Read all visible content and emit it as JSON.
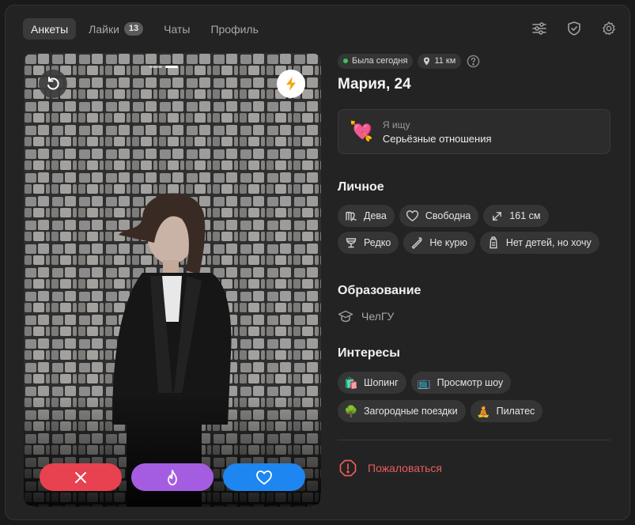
{
  "tabs": [
    {
      "label": "Анкеты",
      "active": true
    },
    {
      "label": "Лайки",
      "badge": "13"
    },
    {
      "label": "Чаты"
    },
    {
      "label": "Профиль"
    }
  ],
  "top_icons": [
    "filters-icon",
    "shield-icon",
    "settings-icon"
  ],
  "photo": {
    "photo_count": 2,
    "current_index": 1,
    "undo_icon": "undo-icon",
    "boost_icon": "lightning-icon"
  },
  "actions": {
    "dislike_icon": "close-icon",
    "super_icon": "flame-icon",
    "like_icon": "heart-icon"
  },
  "profile": {
    "status": "Была сегодня",
    "distance": "11 км",
    "name": "Мария, 24",
    "looking_label": "Я ищу",
    "looking_value": "Серьёзные отношения",
    "looking_emoji": "💘"
  },
  "personal": {
    "title": "Личное",
    "chips": [
      {
        "label": "Дева",
        "icon": "virgo-icon"
      },
      {
        "label": "Свободна",
        "icon": "heart-outline-icon"
      },
      {
        "label": "161 см",
        "icon": "height-icon"
      },
      {
        "label": "Редко",
        "icon": "glass-icon"
      },
      {
        "label": "Не курю",
        "icon": "no-smoking-icon"
      },
      {
        "label": "Нет детей, но хочу",
        "icon": "bottle-icon"
      }
    ]
  },
  "education": {
    "title": "Образование",
    "value": "ЧелГУ"
  },
  "interests": {
    "title": "Интересы",
    "chips": [
      {
        "label": "Шопинг",
        "emoji": "🛍️"
      },
      {
        "label": "Просмотр шоу",
        "emoji": "📺"
      },
      {
        "label": "Загородные поездки",
        "emoji": "🌳"
      },
      {
        "label": "Пилатес",
        "emoji": "🧘"
      }
    ]
  },
  "report_label": "Пожаловаться",
  "colors": {
    "dislike": "#e8414f",
    "superlike": "#a45de0",
    "like": "#1e86f0",
    "online": "#3dc35c",
    "report": "#ea5b5b"
  }
}
